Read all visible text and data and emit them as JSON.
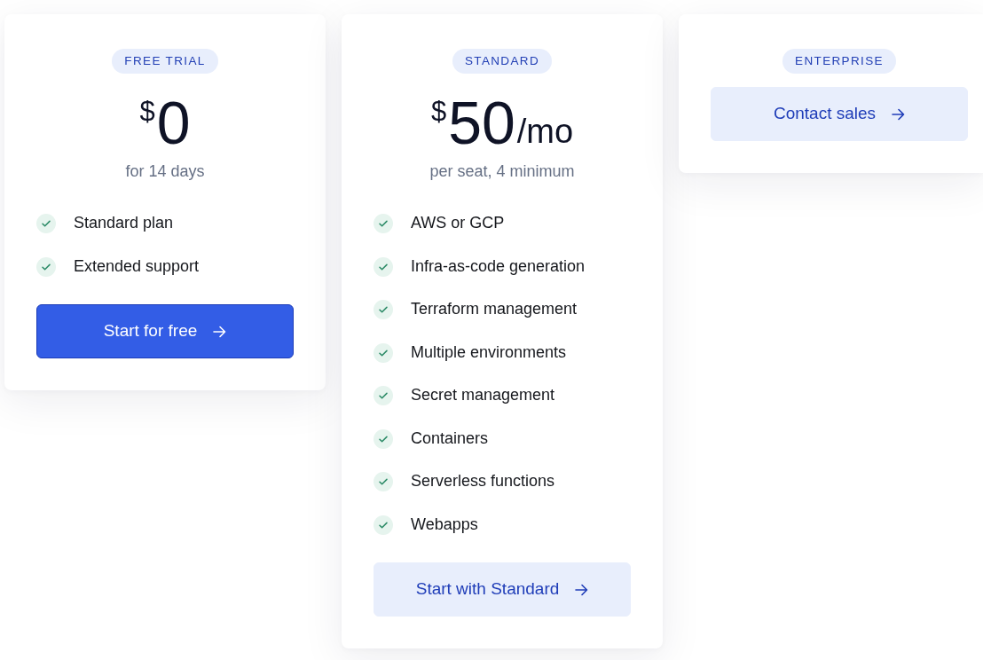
{
  "plans": [
    {
      "badge": "FREE TRIAL",
      "price": {
        "currency": "$",
        "amount": "0"
      },
      "note": "for 14 days",
      "features": [
        "Standard plan",
        "Extended support"
      ],
      "button": {
        "label": "Start for free",
        "kind": "primary"
      }
    },
    {
      "badge": "STANDARD",
      "price": {
        "currency": "$",
        "amount": "50",
        "period": "/mo"
      },
      "note": "per seat, 4 minimum",
      "features": [
        "AWS or GCP",
        "Infra-as-code generation",
        "Terraform management",
        "Multiple environments",
        "Secret management",
        "Containers",
        "Serverless functions",
        "Webapps"
      ],
      "button": {
        "label": "Start with Standard",
        "kind": "secondary"
      }
    },
    {
      "badge": "ENTERPRISE",
      "button": {
        "label": "Contact sales",
        "kind": "secondary"
      }
    }
  ]
}
